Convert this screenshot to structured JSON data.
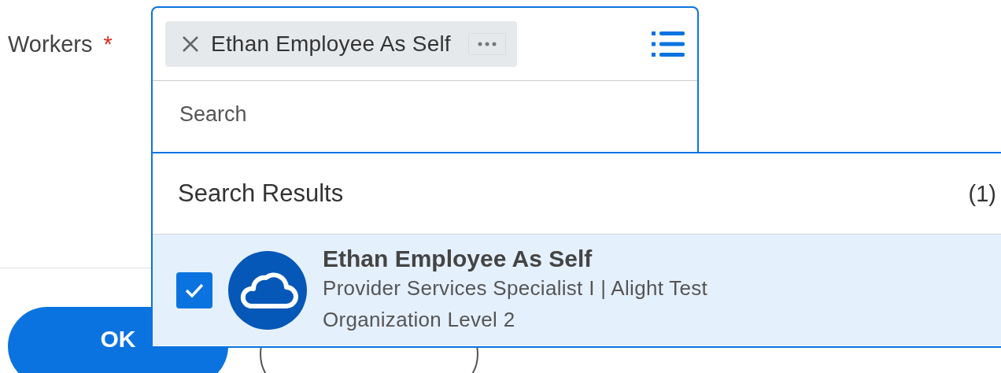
{
  "form": {
    "label": "Workers",
    "required_mark": "*"
  },
  "field": {
    "tokens": [
      {
        "label": "Ethan Employee As Self"
      }
    ],
    "placeholder": "Search"
  },
  "results": {
    "title": "Search Results",
    "count": "(1)",
    "items": [
      {
        "name": "Ethan Employee As Self",
        "detail": "Provider Services Specialist I | Alight Test Organization Level 2",
        "selected": true
      }
    ]
  },
  "buttons": [
    {
      "kind": "primary",
      "label": "OK"
    },
    {
      "kind": "secondary"
    }
  ]
}
